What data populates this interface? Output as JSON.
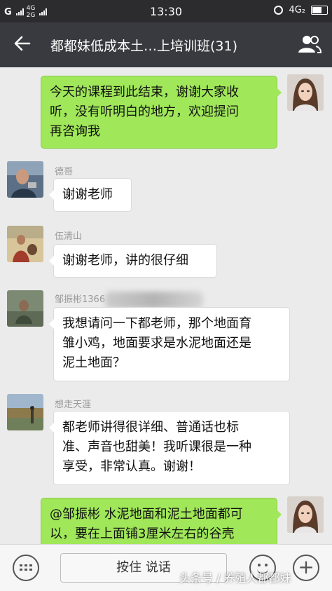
{
  "status_bar": {
    "carrier_g": "G",
    "network_top": "4G",
    "network_bottom": "2G",
    "time": "13:30",
    "network_right": "4G₂"
  },
  "header": {
    "back_icon": "back-arrow-icon",
    "title": "都都妹低成本土…上培训班(31)",
    "members_icon": "group-members-icon"
  },
  "messages": [
    {
      "side": "right",
      "sender": "",
      "lines": [
        "今天的课程到此结束，谢谢大家收",
        "听，没有听明白的地方，欢迎提问",
        "再咨询我"
      ]
    },
    {
      "side": "left",
      "sender": "德哥",
      "lines": [
        "谢谢老师"
      ]
    },
    {
      "side": "left",
      "sender": "伍清山",
      "lines": [
        "谢谢老师，讲的很仔细"
      ]
    },
    {
      "side": "left",
      "sender": "邹振彬1366",
      "lines": [
        "我想请问一下都老师，那个地面育",
        "雏小鸡，地面要求是水泥地面还是",
        "泥土地面？"
      ]
    },
    {
      "side": "left",
      "sender": "想走天涯",
      "lines": [
        "都老师讲得很详细、普通话也标",
        "准、声音也甜美！我听课很是一种",
        "享受，非常认真。谢谢！"
      ]
    },
    {
      "side": "right",
      "sender": "",
      "lines": [
        "@邹振彬 水泥地面和泥土地面都可",
        "以，要在上面铺3厘米左右的谷壳"
      ]
    }
  ],
  "input_bar": {
    "keyboard_icon": "keyboard-icon",
    "hold_to_talk": "按住 说话",
    "emoji_icon": "emoji-icon",
    "plus_icon": "plus-icon"
  },
  "watermark": "头条号 / 养殖人都都妹",
  "colors": {
    "status_bar": "#2c2c2e",
    "title_bar": "#393a3f",
    "chat_bg": "#ebebeb",
    "bubble_self": "#a0e759",
    "bubble_other": "#ffffff",
    "sender_name": "#999999"
  }
}
